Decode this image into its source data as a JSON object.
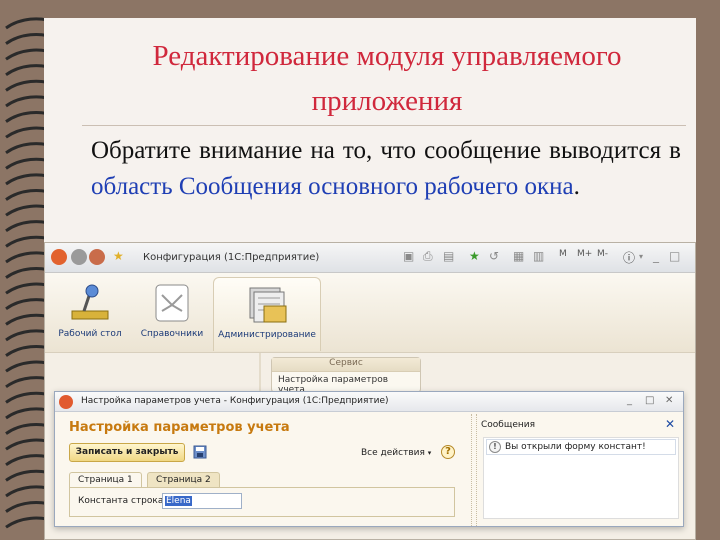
{
  "slide": {
    "title_line1": "Редактирование модуля управляемого",
    "title_line2": "приложения",
    "body_pre": "Обратите внимание на то, что сообщение выводится в ",
    "body_highlight": "область Сообщения основного рабочего окна",
    "body_post": "."
  },
  "app": {
    "title": "Конфигурация (1С:Предприятие)",
    "sections": [
      {
        "label": "Рабочий стол",
        "icon": "desktop-icon"
      },
      {
        "label": "Справочники",
        "icon": "catalogs-icon"
      },
      {
        "label": "Администрирование",
        "icon": "administration-icon"
      }
    ],
    "service_menu": {
      "header": "Сервис",
      "item": "Настройка параметров учета"
    },
    "toolbar": {
      "m_label": "M",
      "mplus_label": "M+",
      "mminus_label": "M-"
    }
  },
  "dialog": {
    "window_title": "Настройка параметров учета - Конфигурация (1С:Предприятие)",
    "form_title": "Настройка параметров учета",
    "save_close_label": "Записать и закрыть",
    "all_actions_label": "Все действия",
    "tabs": [
      "Страница 1",
      "Страница 2"
    ],
    "field_label": "Константа строка:",
    "field_value": "Elena"
  },
  "messages": {
    "title": "Сообщения",
    "items": [
      "Вы открыли форму констант!"
    ]
  },
  "colors": {
    "title_red": "#d0283c",
    "link_blue": "#1f3fb4",
    "form_title_orange": "#c77a10"
  }
}
